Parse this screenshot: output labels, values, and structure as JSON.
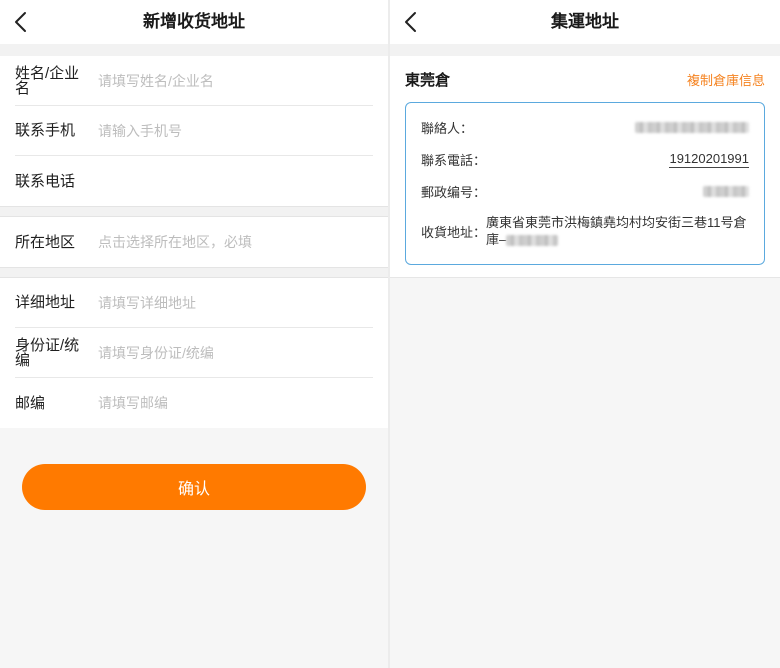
{
  "colors": {
    "accent": "#ff7a00",
    "copy_link": "#f5821f",
    "card_border": "#5ba9de"
  },
  "left": {
    "back_icon": "chevron-left-icon",
    "title": "新增收货地址",
    "fields": [
      {
        "label": "姓名/企业名",
        "placeholder": "请填写姓名/企业名"
      },
      {
        "label": "联系手机",
        "placeholder": "请输入手机号"
      },
      {
        "label": "联系电话"
      },
      {
        "label": "所在地区",
        "placeholder": "点击选择所在地区，必填"
      },
      {
        "label": "详细地址",
        "placeholder": "请填写详细地址"
      },
      {
        "label": "身份证/统编",
        "placeholder": "请填写身份证/统编"
      },
      {
        "label": "邮编",
        "placeholder": "请填写邮编"
      }
    ],
    "confirm_label": "确认"
  },
  "right": {
    "back_icon": "chevron-left-icon",
    "title": "集運地址",
    "warehouse_name": "東莞倉",
    "copy_label": "複制倉庫信息",
    "info": {
      "contact_label": "聯絡人：",
      "phone_label": "聯系電話：",
      "phone_value": "19120201991",
      "postal_label": "郵政编号：",
      "address_label": "收貨地址：",
      "address_value": "廣東省東莞市洪梅鎮堯均村均安街三巷11号倉庫–"
    }
  }
}
